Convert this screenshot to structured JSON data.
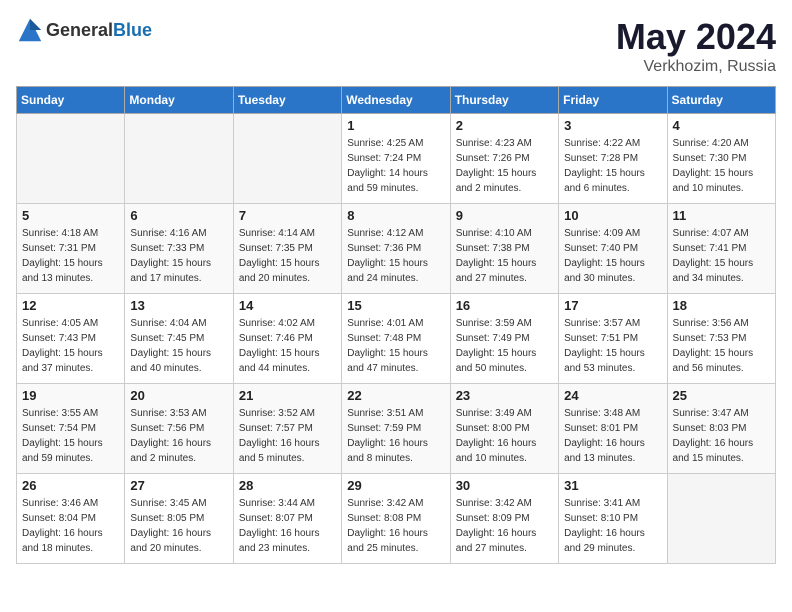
{
  "header": {
    "logo_general": "General",
    "logo_blue": "Blue",
    "title": "May 2024",
    "location": "Verkhozim, Russia"
  },
  "days_of_week": [
    "Sunday",
    "Monday",
    "Tuesday",
    "Wednesday",
    "Thursday",
    "Friday",
    "Saturday"
  ],
  "weeks": [
    [
      {
        "day": "",
        "empty": true
      },
      {
        "day": "",
        "empty": true
      },
      {
        "day": "",
        "empty": true
      },
      {
        "day": "1",
        "sunrise": "4:25 AM",
        "sunset": "7:24 PM",
        "daylight": "14 hours and 59 minutes."
      },
      {
        "day": "2",
        "sunrise": "4:23 AM",
        "sunset": "7:26 PM",
        "daylight": "15 hours and 2 minutes."
      },
      {
        "day": "3",
        "sunrise": "4:22 AM",
        "sunset": "7:28 PM",
        "daylight": "15 hours and 6 minutes."
      },
      {
        "day": "4",
        "sunrise": "4:20 AM",
        "sunset": "7:30 PM",
        "daylight": "15 hours and 10 minutes."
      }
    ],
    [
      {
        "day": "5",
        "sunrise": "4:18 AM",
        "sunset": "7:31 PM",
        "daylight": "15 hours and 13 minutes."
      },
      {
        "day": "6",
        "sunrise": "4:16 AM",
        "sunset": "7:33 PM",
        "daylight": "15 hours and 17 minutes."
      },
      {
        "day": "7",
        "sunrise": "4:14 AM",
        "sunset": "7:35 PM",
        "daylight": "15 hours and 20 minutes."
      },
      {
        "day": "8",
        "sunrise": "4:12 AM",
        "sunset": "7:36 PM",
        "daylight": "15 hours and 24 minutes."
      },
      {
        "day": "9",
        "sunrise": "4:10 AM",
        "sunset": "7:38 PM",
        "daylight": "15 hours and 27 minutes."
      },
      {
        "day": "10",
        "sunrise": "4:09 AM",
        "sunset": "7:40 PM",
        "daylight": "15 hours and 30 minutes."
      },
      {
        "day": "11",
        "sunrise": "4:07 AM",
        "sunset": "7:41 PM",
        "daylight": "15 hours and 34 minutes."
      }
    ],
    [
      {
        "day": "12",
        "sunrise": "4:05 AM",
        "sunset": "7:43 PM",
        "daylight": "15 hours and 37 minutes."
      },
      {
        "day": "13",
        "sunrise": "4:04 AM",
        "sunset": "7:45 PM",
        "daylight": "15 hours and 40 minutes."
      },
      {
        "day": "14",
        "sunrise": "4:02 AM",
        "sunset": "7:46 PM",
        "daylight": "15 hours and 44 minutes."
      },
      {
        "day": "15",
        "sunrise": "4:01 AM",
        "sunset": "7:48 PM",
        "daylight": "15 hours and 47 minutes."
      },
      {
        "day": "16",
        "sunrise": "3:59 AM",
        "sunset": "7:49 PM",
        "daylight": "15 hours and 50 minutes."
      },
      {
        "day": "17",
        "sunrise": "3:57 AM",
        "sunset": "7:51 PM",
        "daylight": "15 hours and 53 minutes."
      },
      {
        "day": "18",
        "sunrise": "3:56 AM",
        "sunset": "7:53 PM",
        "daylight": "15 hours and 56 minutes."
      }
    ],
    [
      {
        "day": "19",
        "sunrise": "3:55 AM",
        "sunset": "7:54 PM",
        "daylight": "15 hours and 59 minutes."
      },
      {
        "day": "20",
        "sunrise": "3:53 AM",
        "sunset": "7:56 PM",
        "daylight": "16 hours and 2 minutes."
      },
      {
        "day": "21",
        "sunrise": "3:52 AM",
        "sunset": "7:57 PM",
        "daylight": "16 hours and 5 minutes."
      },
      {
        "day": "22",
        "sunrise": "3:51 AM",
        "sunset": "7:59 PM",
        "daylight": "16 hours and 8 minutes."
      },
      {
        "day": "23",
        "sunrise": "3:49 AM",
        "sunset": "8:00 PM",
        "daylight": "16 hours and 10 minutes."
      },
      {
        "day": "24",
        "sunrise": "3:48 AM",
        "sunset": "8:01 PM",
        "daylight": "16 hours and 13 minutes."
      },
      {
        "day": "25",
        "sunrise": "3:47 AM",
        "sunset": "8:03 PM",
        "daylight": "16 hours and 15 minutes."
      }
    ],
    [
      {
        "day": "26",
        "sunrise": "3:46 AM",
        "sunset": "8:04 PM",
        "daylight": "16 hours and 18 minutes."
      },
      {
        "day": "27",
        "sunrise": "3:45 AM",
        "sunset": "8:05 PM",
        "daylight": "16 hours and 20 minutes."
      },
      {
        "day": "28",
        "sunrise": "3:44 AM",
        "sunset": "8:07 PM",
        "daylight": "16 hours and 23 minutes."
      },
      {
        "day": "29",
        "sunrise": "3:42 AM",
        "sunset": "8:08 PM",
        "daylight": "16 hours and 25 minutes."
      },
      {
        "day": "30",
        "sunrise": "3:42 AM",
        "sunset": "8:09 PM",
        "daylight": "16 hours and 27 minutes."
      },
      {
        "day": "31",
        "sunrise": "3:41 AM",
        "sunset": "8:10 PM",
        "daylight": "16 hours and 29 minutes."
      },
      {
        "day": "",
        "empty": true
      }
    ]
  ]
}
